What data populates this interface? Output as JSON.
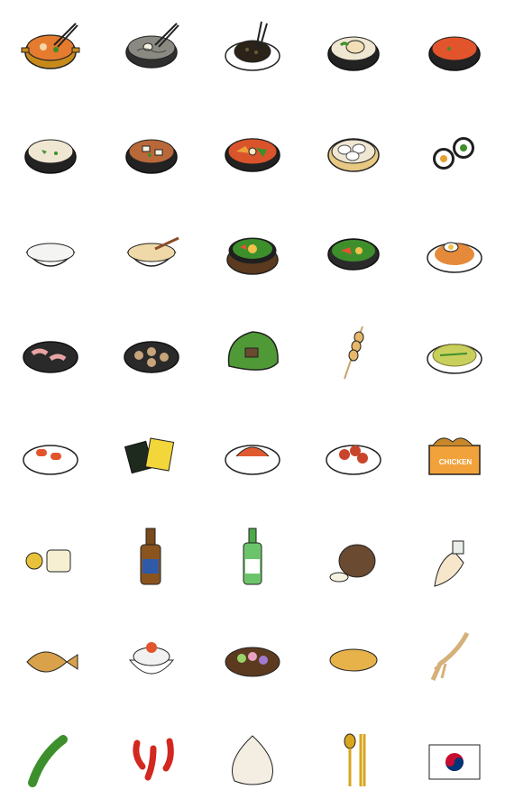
{
  "sheet": {
    "columns": 5,
    "rows": 8,
    "items": [
      {
        "icon": "kimchi-stew-pot-icon"
      },
      {
        "icon": "cold-noodles-bowl-icon"
      },
      {
        "icon": "black-bean-noodles-plate-icon"
      },
      {
        "icon": "ginseng-chicken-soup-icon"
      },
      {
        "icon": "spicy-red-stew-icon"
      },
      {
        "icon": "bone-broth-soup-icon"
      },
      {
        "icon": "soybean-paste-stew-icon"
      },
      {
        "icon": "spicy-hot-pot-icon"
      },
      {
        "icon": "dumplings-steamer-icon"
      },
      {
        "icon": "kimbap-rolls-icon"
      },
      {
        "icon": "rice-bowl-icon"
      },
      {
        "icon": "rice-porridge-icon"
      },
      {
        "icon": "stone-pot-bibimbap-icon"
      },
      {
        "icon": "bibimbap-bowl-icon"
      },
      {
        "icon": "kimchi-fried-rice-icon"
      },
      {
        "icon": "pork-belly-grill-icon"
      },
      {
        "icon": "grilled-meat-pieces-icon"
      },
      {
        "icon": "lettuce-wrap-icon"
      },
      {
        "icon": "skewer-icon"
      },
      {
        "icon": "pancake-icon"
      },
      {
        "icon": "tteokbokki-plate-icon"
      },
      {
        "icon": "seaweed-snacks-icon"
      },
      {
        "icon": "kimchi-plate-icon"
      },
      {
        "icon": "spicy-chicken-plate-icon"
      },
      {
        "icon": "fried-chicken-box-icon",
        "text": "CHICKEN"
      },
      {
        "icon": "citron-tea-icon"
      },
      {
        "icon": "beer-bottle-icon"
      },
      {
        "icon": "soju-bottle-icon"
      },
      {
        "icon": "makgeolli-jar-icon"
      },
      {
        "icon": "cheers-glass-hand-icon"
      },
      {
        "icon": "fish-shaped-bread-icon"
      },
      {
        "icon": "shaved-ice-dessert-icon"
      },
      {
        "icon": "rice-cakes-plate-icon"
      },
      {
        "icon": "sweet-pancake-icon"
      },
      {
        "icon": "ginseng-root-icon"
      },
      {
        "icon": "green-pepper-icon"
      },
      {
        "icon": "red-peppers-icon"
      },
      {
        "icon": "garlic-bulb-icon"
      },
      {
        "icon": "spoon-chopsticks-icon"
      },
      {
        "icon": "korean-flag-icon"
      }
    ]
  },
  "colors": {
    "outline": "#1e1e1e",
    "stone_pot": "#2a2a2a",
    "red_broth": "#e2552c",
    "gold": "#d8a51d",
    "green": "#3d8f2c",
    "cream": "#efe7d2"
  }
}
